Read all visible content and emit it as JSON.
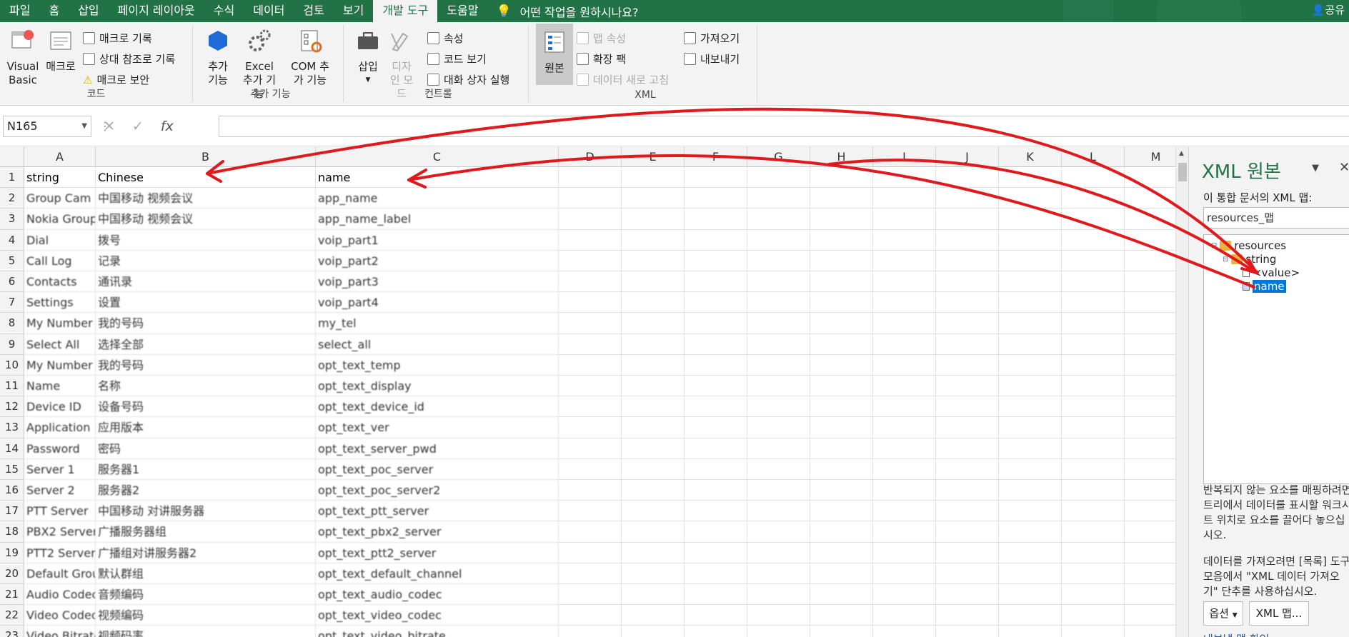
{
  "ribbon_tabs": [
    "파일",
    "홈",
    "삽입",
    "페이지 레이아웃",
    "수식",
    "데이터",
    "검토",
    "보기",
    "개발 도구",
    "도움말"
  ],
  "active_tab": "개발 도구",
  "tell_me": "어떤 작업을 원하시나요?",
  "share": "공유",
  "groups": {
    "code": {
      "label": "코드",
      "visual_basic": "Visual Basic",
      "macro": "매크로",
      "record_macro": "매크로 기록",
      "relative_ref": "상대 참조로 기록",
      "macro_security": "매크로 보안"
    },
    "addins": {
      "label": "추가 기능",
      "addins_btn": "추가 기능",
      "excel_addins": "Excel 추가 기능",
      "com_addins": "COM 추가 기능"
    },
    "controls": {
      "label": "컨트롤",
      "insert": "삽입",
      "design_mode": "디자인 모드",
      "properties": "속성",
      "view_code": "코드 보기",
      "run_dialog": "대화 상자 실행"
    },
    "xml": {
      "label": "XML",
      "source": "원본",
      "map_props": "맵 속성",
      "expansion": "확장 팩",
      "refresh": "데이터 새로 고침",
      "import": "가져오기",
      "export": "내보내기"
    }
  },
  "formula_bar": {
    "name_box": "N165",
    "cancel": "✕",
    "enter": "✓",
    "fx": "fx",
    "formula": ""
  },
  "columns": [
    "A",
    "B",
    "C",
    "D",
    "E",
    "F",
    "G",
    "H",
    "I",
    "J",
    "K",
    "L",
    "M"
  ],
  "rows": [
    {
      "n": "1",
      "a": "string",
      "b": "Chinese",
      "c": "name"
    },
    {
      "n": "2",
      "a": "Group Cam",
      "b": "中国移动 视频会议",
      "c": "app_name"
    },
    {
      "n": "3",
      "a": "Nokia Group",
      "b": "中国移动 视频会议",
      "c": "app_name_label"
    },
    {
      "n": "4",
      "a": "Dial",
      "b": "拨号",
      "c": "voip_part1"
    },
    {
      "n": "5",
      "a": "Call Log",
      "b": "记录",
      "c": "voip_part2"
    },
    {
      "n": "6",
      "a": "Contacts",
      "b": "通讯录",
      "c": "voip_part3"
    },
    {
      "n": "7",
      "a": "Settings",
      "b": "设置",
      "c": "voip_part4"
    },
    {
      "n": "8",
      "a": "My Number",
      "b": "我的号码",
      "c": "my_tel"
    },
    {
      "n": "9",
      "a": "Select All",
      "b": "选择全部",
      "c": "select_all"
    },
    {
      "n": "10",
      "a": "My Number",
      "b": "我的号码",
      "c": "opt_text_temp"
    },
    {
      "n": "11",
      "a": "Name",
      "b": "名称",
      "c": "opt_text_display"
    },
    {
      "n": "12",
      "a": "Device ID",
      "b": "设备号码",
      "c": "opt_text_device_id"
    },
    {
      "n": "13",
      "a": "Application",
      "b": "应用版本",
      "c": "opt_text_ver"
    },
    {
      "n": "14",
      "a": "Password",
      "b": "密码",
      "c": "opt_text_server_pwd"
    },
    {
      "n": "15",
      "a": "Server 1",
      "b": "服务器1",
      "c": "opt_text_poc_server"
    },
    {
      "n": "16",
      "a": "Server 2",
      "b": "服务器2",
      "c": "opt_text_poc_server2"
    },
    {
      "n": "17",
      "a": "PTT Server",
      "b": "中国移动 对讲服务器",
      "c": "opt_text_ptt_server"
    },
    {
      "n": "18",
      "a": "PBX2 Server",
      "b": "广播服务器组",
      "c": "opt_text_pbx2_server"
    },
    {
      "n": "19",
      "a": "PTT2 Server",
      "b": "广播组对讲服务器2",
      "c": "opt_text_ptt2_server"
    },
    {
      "n": "20",
      "a": "Default Group",
      "b": "默认群组",
      "c": "opt_text_default_channel"
    },
    {
      "n": "21",
      "a": "Audio Codec",
      "b": "音频编码",
      "c": "opt_text_audio_codec"
    },
    {
      "n": "22",
      "a": "Video Codec",
      "b": "视频编码",
      "c": "opt_text_video_codec"
    },
    {
      "n": "23",
      "a": "Video Bitrate",
      "b": "视频码率",
      "c": "opt_text_video_bitrate"
    }
  ],
  "xml_pane": {
    "title": "XML 원본",
    "maps_label": "이 통합 문서의 XML 맵:",
    "selected_map": "resources_맵",
    "tree": [
      {
        "label": "resources",
        "kind": "folder"
      },
      {
        "label": "string",
        "kind": "folder"
      },
      {
        "label": "<value>",
        "kind": "element"
      },
      {
        "label": "name",
        "kind": "attribute",
        "selected": true
      }
    ],
    "help_text_1": "반복되지 않는 요소를 매핑하려면 트리에서 데이터를 표시할 워크시트 위치로 요소를 끌어다 놓으십시오.",
    "help_text_2": "데이터를 가져오려면 [목록] 도구 모음에서 \"XML 데이터 가져오기\" 단추를 사용하십시오.",
    "options_btn": "옵션",
    "xml_maps_btn": "XML 맵...",
    "verify_link": "내보낼 맵 확인..."
  },
  "colors": {
    "excel_green": "#217346",
    "arrow_red": "#e0191c",
    "selection_blue": "#0078d7"
  }
}
